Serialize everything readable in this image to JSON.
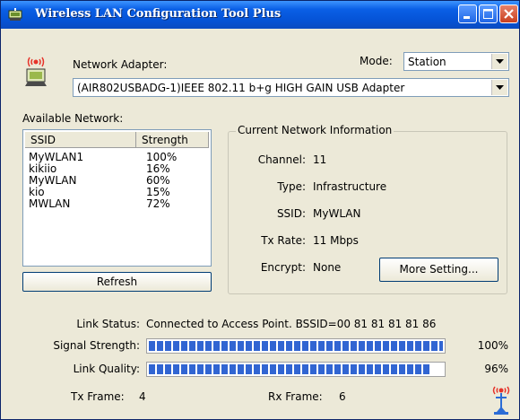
{
  "window": {
    "title": "Wireless LAN Configuration Tool Plus",
    "accent": "#0a5fe6",
    "icons": [
      "app-icon",
      "minimize-icon",
      "maximize-icon",
      "close-icon"
    ]
  },
  "adapter": {
    "label": "Network Adapter:",
    "value": "(AIR802USBADG-1)IEEE 802.11 b+g HIGH GAIN USB Adapter",
    "icon": "wireless-adapter-icon"
  },
  "mode": {
    "label": "Mode:",
    "value": "Station"
  },
  "available": {
    "label": "Available Network:",
    "columns": [
      "SSID",
      "Strength"
    ],
    "rows": [
      {
        "ssid": "MyWLAN1",
        "strength": "100%"
      },
      {
        "ssid": "kikiio",
        "strength": "16%"
      },
      {
        "ssid": "MyWLAN",
        "strength": "60%"
      },
      {
        "ssid": "kio",
        "strength": "15%"
      },
      {
        "ssid": "MWLAN",
        "strength": "72%"
      }
    ],
    "refresh_label": "Refresh"
  },
  "current": {
    "title": "Current Network Information",
    "channel_label": "Channel:",
    "channel_value": "11",
    "type_label": "Type:",
    "type_value": "Infrastructure",
    "ssid_label": "SSID:",
    "ssid_value": "MyWLAN",
    "txrate_label": "Tx Rate:",
    "txrate_value": "11 Mbps",
    "encrypt_label": "Encrypt:",
    "encrypt_value": "None",
    "more_label": "More Setting..."
  },
  "status": {
    "link_label": "Link Status:",
    "link_value": "Connected to Access Point. BSSID=00 81 81 81 81 86",
    "signal_label": "Signal Strength:",
    "signal_value": "100%",
    "signal_fraction": 1.0,
    "quality_label": "Link Quality:",
    "quality_value": "96%",
    "quality_fraction": 0.96,
    "tx_label": "Tx Frame:",
    "tx_value": "4",
    "rx_label": "Rx Frame:",
    "rx_value": "6",
    "antenna_icon": "antenna-icon"
  }
}
